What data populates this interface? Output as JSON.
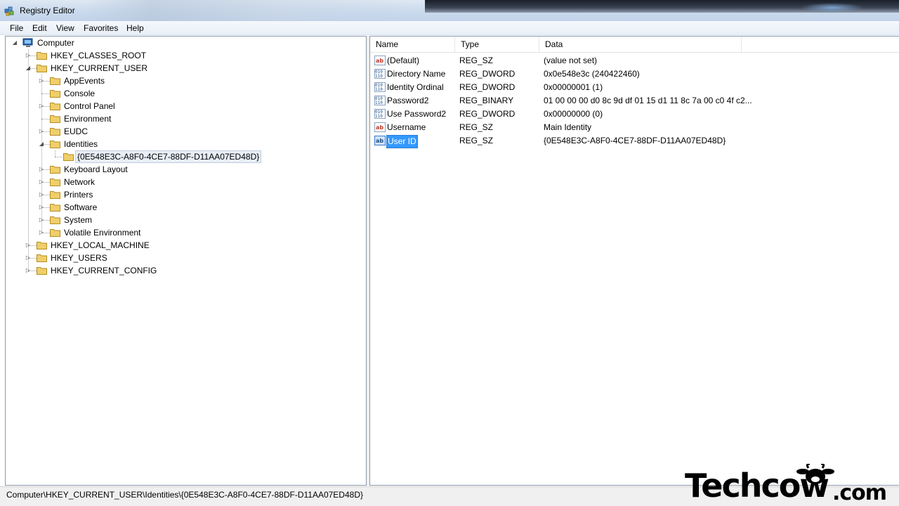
{
  "window": {
    "title": "Registry Editor"
  },
  "menu": [
    "File",
    "Edit",
    "View",
    "Favorites",
    "Help"
  ],
  "tree": {
    "root": "Computer",
    "hives": {
      "classes_root": "HKEY_CLASSES_ROOT",
      "current_user": "HKEY_CURRENT_USER",
      "local_machine": "HKEY_LOCAL_MACHINE",
      "users": "HKEY_USERS",
      "current_config": "HKEY_CURRENT_CONFIG"
    },
    "current_user_children": [
      "AppEvents",
      "Console",
      "Control Panel",
      "Environment",
      "EUDC",
      "Identities",
      "Keyboard Layout",
      "Network",
      "Printers",
      "Software",
      "System",
      "Volatile Environment"
    ],
    "identity_key": "{0E548E3C-A8F0-4CE7-88DF-D11AA07ED48D}"
  },
  "columns": {
    "name": "Name",
    "type": "Type",
    "data": "Data"
  },
  "values": [
    {
      "name": "(Default)",
      "type": "REG_SZ",
      "data": "(value not set)",
      "icon": "string-value-icon"
    },
    {
      "name": "Directory Name",
      "type": "REG_DWORD",
      "data": "0x0e548e3c (240422460)",
      "icon": "binary-value-icon"
    },
    {
      "name": "Identity Ordinal",
      "type": "REG_DWORD",
      "data": "0x00000001 (1)",
      "icon": "binary-value-icon"
    },
    {
      "name": "Password2",
      "type": "REG_BINARY",
      "data": "01 00 00 00 d0 8c 9d df 01 15 d1 11 8c 7a 00 c0 4f c2...",
      "icon": "binary-value-icon"
    },
    {
      "name": "Use Password2",
      "type": "REG_DWORD",
      "data": "0x00000000 (0)",
      "icon": "binary-value-icon"
    },
    {
      "name": "Username",
      "type": "REG_SZ",
      "data": "Main Identity",
      "icon": "string-value-icon"
    },
    {
      "name": "User ID",
      "type": "REG_SZ",
      "data": "{0E548E3C-A8F0-4CE7-88DF-D11AA07ED48D}",
      "icon": "string-value-icon"
    }
  ],
  "status": {
    "path": "Computer\\HKEY_CURRENT_USER\\Identities\\{0E548E3C-A8F0-4CE7-88DF-D11AA07ED48D}"
  },
  "watermark": {
    "brand": "Techcow",
    "suffix": ".com"
  },
  "colors": {
    "selection": "#3399ff",
    "folder": "#e8c35a",
    "titlebar": "#c9d9ec"
  }
}
